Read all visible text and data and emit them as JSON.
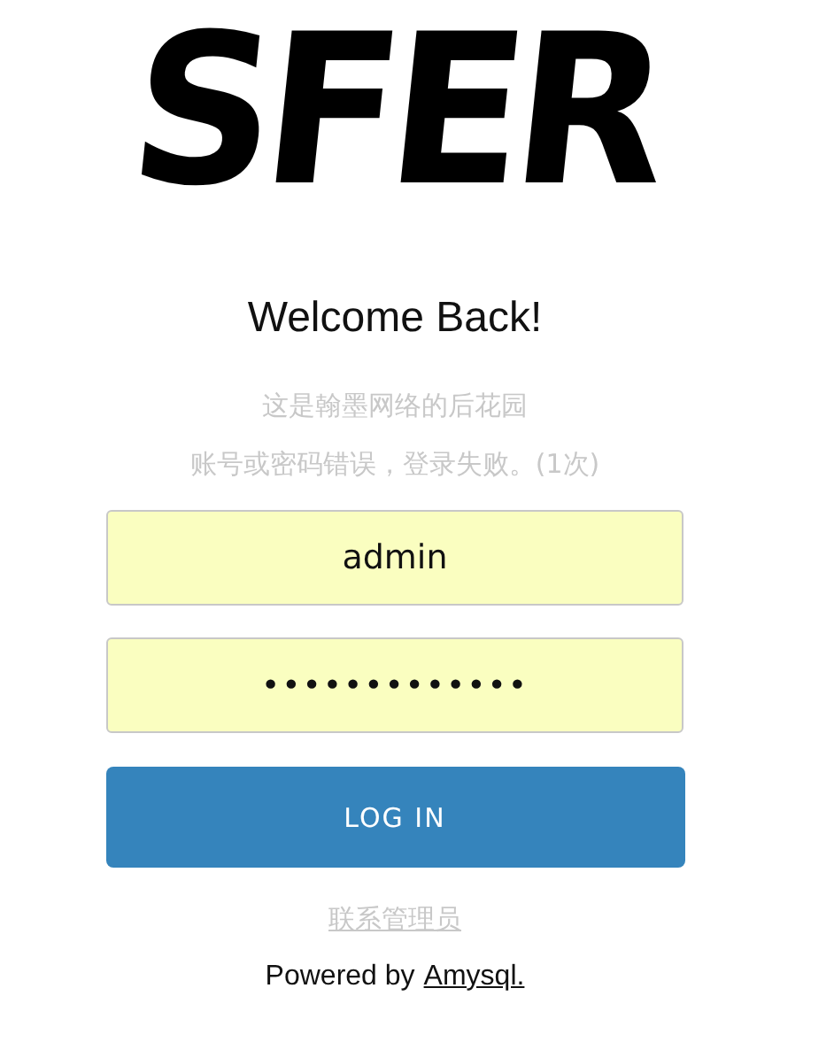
{
  "logo": "SFER",
  "heading": "Welcome Back!",
  "subtitle": "这是翰墨网络的后花园",
  "error": "账号或密码错误，登录失败。(1次)",
  "fields": [
    {
      "kind": "text",
      "value": "admin"
    },
    {
      "kind": "password",
      "value": "•••••••••••••"
    }
  ],
  "login_button": "LOG IN",
  "contact_link": "联系管理员",
  "footer": {
    "text": "Powered by",
    "link": "Amysql."
  }
}
